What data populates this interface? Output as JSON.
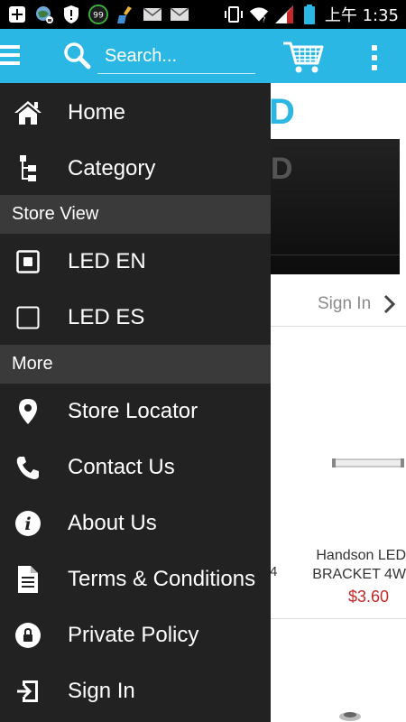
{
  "status_bar": {
    "time": "上午 1:35",
    "badge": "99"
  },
  "app_bar": {
    "search": {
      "placeholder": "Search..."
    }
  },
  "background_page": {
    "logo_fragment": "D",
    "banner_letter": "D",
    "sign_in_label": "Sign In",
    "fragment_4": "4",
    "product": {
      "name": "Handson LED BRACKET 4W",
      "price": "$3.60",
      "price_color": "#c62828"
    }
  },
  "drawer": {
    "items_top": [
      {
        "label": "Home",
        "icon": "home-icon"
      },
      {
        "label": "Category",
        "icon": "category-tree-icon"
      }
    ],
    "store_view_header": "Store View",
    "store_views": [
      {
        "label": "LED EN",
        "icon": "radio-selected-icon",
        "selected": true
      },
      {
        "label": "LED ES",
        "icon": "radio-unselected-icon",
        "selected": false
      }
    ],
    "more_header": "More",
    "items_more": [
      {
        "label": "Store Locator",
        "icon": "location-pin-icon"
      },
      {
        "label": "Contact Us",
        "icon": "phone-icon"
      },
      {
        "label": "About Us",
        "icon": "info-icon"
      },
      {
        "label": "Terms & Conditions",
        "icon": "document-icon"
      },
      {
        "label": "Private Policy",
        "icon": "lock-icon"
      },
      {
        "label": "Sign In",
        "icon": "sign-in-icon"
      }
    ]
  },
  "colors": {
    "app_bar": "#2ab7e3",
    "drawer_background": "#222222",
    "section_header": "#3a3a3a",
    "price": "#c62828"
  }
}
